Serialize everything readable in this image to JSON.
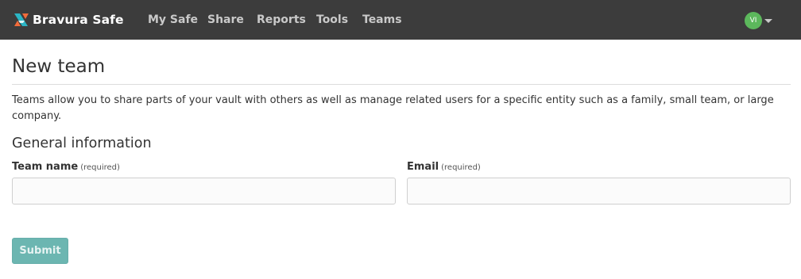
{
  "app": {
    "brand_name": "Bravura Safe"
  },
  "nav": {
    "items": [
      {
        "label": "My Safe"
      },
      {
        "label": "Share"
      },
      {
        "label": "Reports"
      },
      {
        "label": "Tools"
      },
      {
        "label": "Teams"
      }
    ]
  },
  "user": {
    "initials": "VI",
    "avatar_color": "#5cb85c"
  },
  "page": {
    "title": "New team",
    "description": "Teams allow you to share parts of your vault with others as well as manage related users for a specific entity such as a family, small team, or large company.",
    "section_heading": "General information"
  },
  "form": {
    "team_name": {
      "label": "Team name",
      "required_note": "(required)",
      "value": ""
    },
    "email": {
      "label": "Email",
      "required_note": "(required)",
      "value": ""
    },
    "submit_label": "Submit"
  },
  "colors": {
    "navbar": "#3c3c3c",
    "submit_button": "#6cb6b1"
  },
  "icons": [
    "bravura-logo-icon",
    "caret-down-icon"
  ]
}
